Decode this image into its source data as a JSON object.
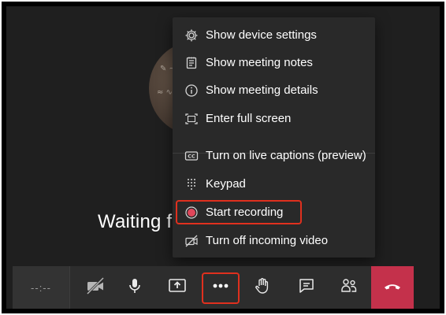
{
  "stage": {
    "waiting_text": "Waiting f"
  },
  "menu": {
    "items": [
      {
        "label": "Show device settings",
        "icon": "gear-icon"
      },
      {
        "label": "Show meeting notes",
        "icon": "notes-icon"
      },
      {
        "label": "Show meeting details",
        "icon": "info-icon"
      },
      {
        "label": "Enter full screen",
        "icon": "fullscreen-icon"
      },
      {
        "label": "Turn on live captions (preview)",
        "icon": "captions-icon"
      },
      {
        "label": "Keypad",
        "icon": "keypad-icon"
      },
      {
        "label": "Start recording",
        "icon": "record-icon"
      },
      {
        "label": "Turn off incoming video",
        "icon": "video-off-icon"
      }
    ]
  },
  "toolbar": {
    "timer": "--:--",
    "buttons": [
      "camera-off-icon",
      "microphone-icon",
      "share-screen-icon",
      "more-actions-icon",
      "raise-hand-icon",
      "chat-icon",
      "participants-icon",
      "hang-up-icon"
    ],
    "hangup_color": "#c4314b"
  },
  "colors": {
    "highlight": "#e0301e",
    "record_dot": "#e0475b",
    "menu_bg": "#292929",
    "stage_bg": "#1f1f1f"
  }
}
